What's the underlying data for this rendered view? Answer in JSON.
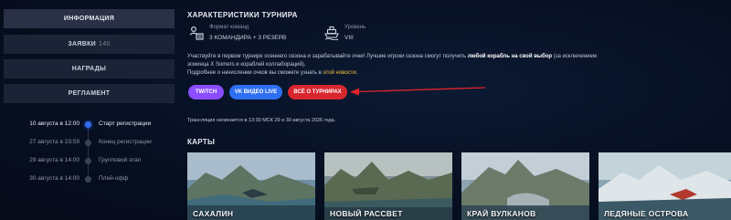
{
  "sidebar": {
    "nav": [
      {
        "label": "Информация",
        "count": ""
      },
      {
        "label": "Заявки",
        "count": "140"
      },
      {
        "label": "Награды",
        "count": ""
      },
      {
        "label": "Регламент",
        "count": ""
      }
    ],
    "timeline": [
      {
        "date": "10 августа в 12:00",
        "label": "Старт регистрации"
      },
      {
        "date": "27 августа в 23:59",
        "label": "Конец регистрации"
      },
      {
        "date": "29 августа в 14:00",
        "label": "Групповой этап"
      },
      {
        "date": "30 августа в 14:00",
        "label": "Плей-офф"
      }
    ]
  },
  "main": {
    "title": "Характеристики турнира",
    "format": {
      "label": "Формат команд",
      "value": "3 командира + 3 резерв",
      "icon": "team-format-icon"
    },
    "level": {
      "label": "Уровень",
      "value": "VIII",
      "icon": "ship-icon"
    },
    "description": {
      "p1_start": "Участвуйте в первом турнире осеннего сезона и зарабатывайте очки! Лучшие игроки сезона смогут получить ",
      "p1_bold": "любой корабль на свой выбор",
      "p1_end": " (за исключением эсминца X Somers и кораблей коллабораций).",
      "p2_start": "Подробнее о начислении очков вы сможете узнать в ",
      "p2_link": "этой новости",
      "p2_end": "."
    },
    "buttons": {
      "twitch": "Twitch",
      "vk": "VK Видео Live",
      "all": "Всё о турнирах"
    },
    "stream_note": "Трансляция начинается в 13:30 МСК 29 и 30 августа 2026 года.",
    "maps_title": "Карты",
    "maps": [
      {
        "name": "Сахалин"
      },
      {
        "name": "Новый рассвет"
      },
      {
        "name": "Край вулканов"
      },
      {
        "name": "Ледяные острова"
      }
    ]
  },
  "colors": {
    "accent": "#2f6df0",
    "twitch": "#8a4dff",
    "vk": "#2e6ff2",
    "red": "#d8262f",
    "link": "#f2c23a"
  }
}
